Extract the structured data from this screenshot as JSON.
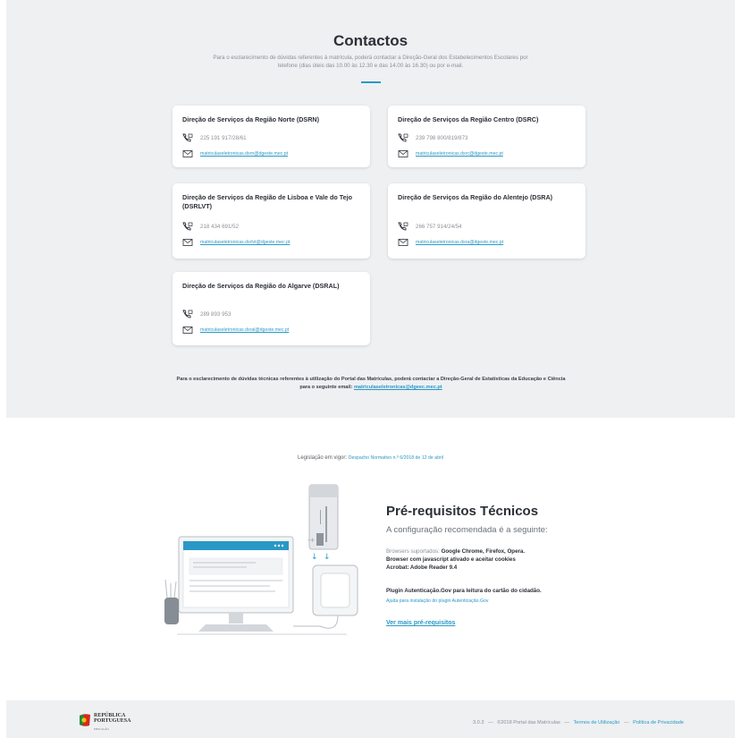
{
  "contacts": {
    "title": "Contactos",
    "subtitle": "Para o esclarecimento de dúvidas referentes à matrícula, poderá contactar a Direção-Geral dos Estabelecimentos Escolares por telefone (dias úteis das 10.00 às 12.30 e das 14.00 às 16.30) ou por e-mail.",
    "cards": [
      {
        "title": "Direção de Serviços da Região Norte (DSRN)",
        "phone": "225 191 917/28/61",
        "email": "matriculaseletronicas.dsrn@dgeste.mec.pt"
      },
      {
        "title": "Direção de Serviços da Região Centro (DSRC)",
        "phone": "239 798 800/819/873",
        "email": "matriculaseletronicas.dsrc@dgeste.mec.pt"
      },
      {
        "title": "Direção de Serviços da Região de Lisboa e Vale do Tejo (DSRLVT)",
        "phone": "218 434 691/52",
        "email": "matriculaseletronicas.dsrlvt@dgeste.mec.pt"
      },
      {
        "title": "Direção de Serviços da Região do Alentejo (DSRA)",
        "phone": "266 757 914/24/54",
        "email": "matriculaseletronicas.dsra@dgeste.mec.pt"
      },
      {
        "title": "Direção de Serviços da Região do Algarve (DSRAL)",
        "phone": "289 893 953",
        "email": "matriculaseletronicas.dsral@dgeste.mec.pt"
      }
    ],
    "tech_text": "Para o esclarecimento de dúvidas técnicas referentes à utilização do Portal das Matrículas, poderá contactar a Direção-Geral de Estatísticas da Educação e Ciência para o seguinte email:",
    "tech_email": "matriculaseletronicas@dgeec.mec.pt"
  },
  "legislation": {
    "label": "Legislação em vigor:",
    "link": "Despacho Normativo n.º 6/2018 de 12 de abril"
  },
  "requirements": {
    "title": "Pré-requisitos Técnicos",
    "subtitle": "A configuração recomendada é a seguinte:",
    "browsers_label": "Browsers suportados:",
    "browsers": "Google Chrome, Firefox, Opera.",
    "javascript": "Browser com javascript ativado e aceitar cookies",
    "acrobat": "Acrobat: Adobe Reader 9.4",
    "plugin": "Plugin Autenticação.Gov para leitura do cartão do cidadão.",
    "plugin_help": "Ajuda para instalação do plugin Autenticação.Gov",
    "more_link": "Ver mais pré-requisitos"
  },
  "footer": {
    "logo_line1": "REPÚBLICA",
    "logo_line2": "PORTUGUESA",
    "logo_line3": "EDUCAÇÃO",
    "version": "3.0.3",
    "copyright": "©2018 Portal das Matrículas",
    "terms": "Termos de Utilização",
    "privacy": "Política de Privacidade",
    "separator": "—"
  },
  "colors": {
    "accent": "#2a98c6",
    "section_bg": "#eef0f2"
  }
}
